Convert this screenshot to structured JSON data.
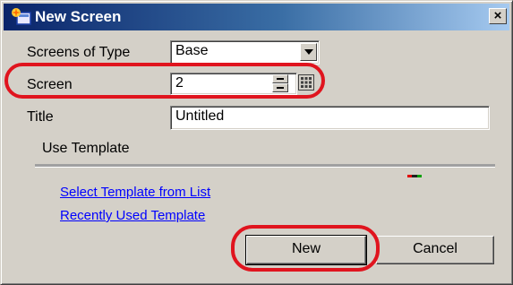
{
  "window": {
    "title": "New Screen",
    "close_glyph": "×",
    "icon": "new-screen-icon"
  },
  "form": {
    "screens_of_type": {
      "label": "Screens of Type",
      "value": "Base"
    },
    "screen": {
      "label": "Screen",
      "value": "2"
    },
    "title": {
      "label": "Title",
      "value": "Untitled"
    },
    "use_template": {
      "label": "Use Template"
    }
  },
  "links": {
    "select_template": "Select Template from List",
    "recent_template": "Recently Used Template"
  },
  "buttons": {
    "new_label": "New",
    "cancel_label": "Cancel"
  },
  "colors": {
    "titlebar_start": "#0a246a",
    "titlebar_end": "#a6caf0",
    "face": "#d4d0c8",
    "link": "#0000ff",
    "highlight": "#e0141e"
  }
}
